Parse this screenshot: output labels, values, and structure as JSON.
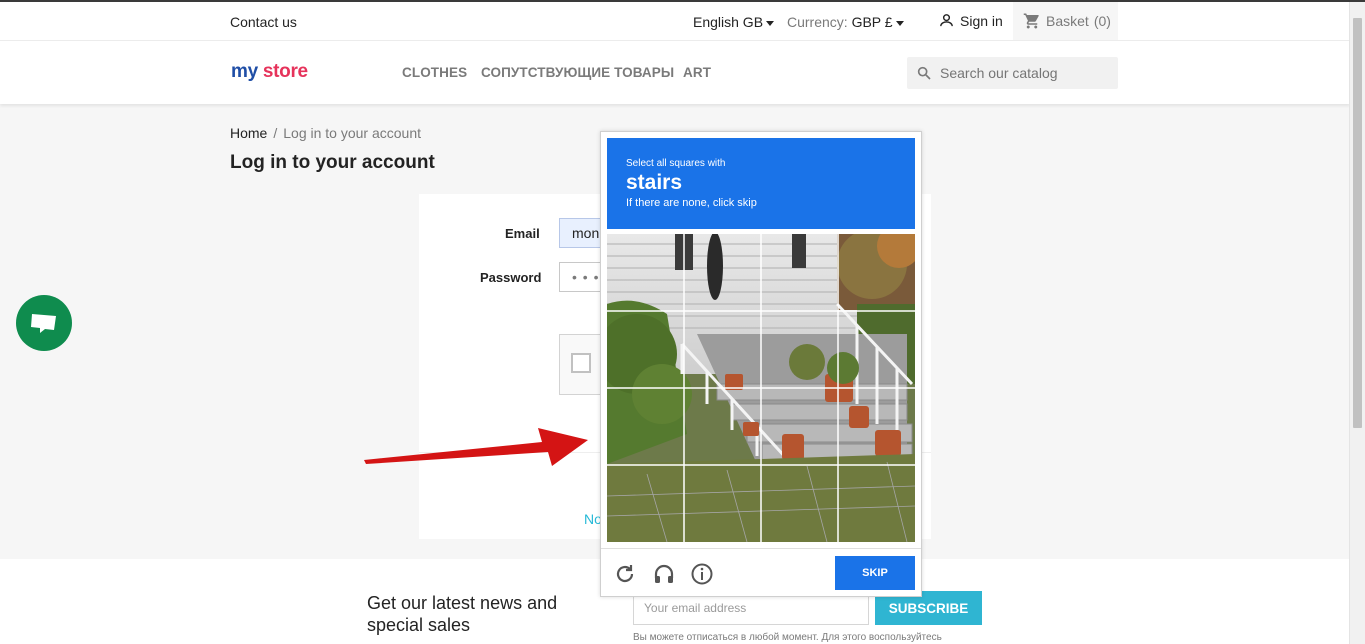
{
  "header": {
    "contact_label": "Contact us",
    "language_label": "English GB",
    "currency_prefix": "Currency:",
    "currency_value": "GBP £",
    "signin_label": "Sign in",
    "basket_label": "Basket",
    "basket_count": "(0)"
  },
  "logo": {
    "part1": "my",
    "part2": "store"
  },
  "nav": {
    "item1": "CLOTHES",
    "item2": "СОПУТСТВУЮЩИЕ ТОВАРЫ",
    "item3": "ART"
  },
  "search": {
    "placeholder": "Search our catalog"
  },
  "breadcrumb": {
    "home": "Home",
    "separator": "/",
    "current": "Log in to your account"
  },
  "page_title": "Log in to your account",
  "login_form": {
    "email_label": "Email",
    "email_value": "mon",
    "password_label": "Password",
    "password_value": "• • •",
    "no_account_partial": "No"
  },
  "captcha": {
    "instruction_line": "Select all squares with",
    "target_word": "stairs",
    "hint": "If there are none, click skip",
    "skip_label": "SKIP",
    "icons": [
      "reload-icon",
      "headphones-icon",
      "info-icon"
    ]
  },
  "footer": {
    "newsletter_text": "Get our latest news and special sales",
    "email_placeholder": "Your email address",
    "subscribe_label": "SUBSCRIBE",
    "note_text": "Вы можете отписаться в любой момент. Для этого воспользуйтесь"
  },
  "colors": {
    "captcha_blue": "#1a73e8",
    "chat_green": "#0f8c4e",
    "accent_cyan": "#2fb5d2",
    "arrow_red": "#d41414"
  }
}
